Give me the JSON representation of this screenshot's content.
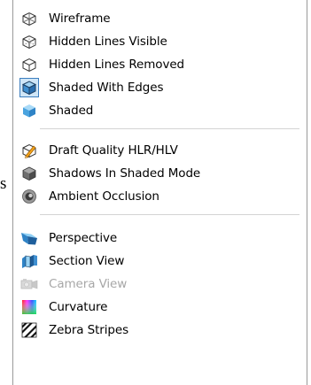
{
  "background_text": "s",
  "menu": {
    "items": [
      {
        "label": "Wireframe",
        "icon": "wireframe-cube-icon"
      },
      {
        "label": "Hidden Lines Visible",
        "icon": "hidden-lines-visible-icon"
      },
      {
        "label": "Hidden Lines Removed",
        "icon": "hidden-lines-removed-icon"
      },
      {
        "label": "Shaded With Edges",
        "icon": "shaded-with-edges-icon",
        "selected": true
      },
      {
        "label": "Shaded",
        "icon": "shaded-cube-icon"
      },
      {
        "label": "Draft Quality HLR/HLV",
        "icon": "draft-quality-icon"
      },
      {
        "label": "Shadows In Shaded Mode",
        "icon": "shadows-icon"
      },
      {
        "label": "Ambient Occlusion",
        "icon": "ambient-occlusion-icon"
      },
      {
        "label": "Perspective",
        "icon": "perspective-icon"
      },
      {
        "label": "Section View",
        "icon": "section-view-icon"
      },
      {
        "label": "Camera View",
        "icon": "camera-view-icon",
        "disabled": true
      },
      {
        "label": "Curvature",
        "icon": "curvature-icon"
      },
      {
        "label": "Zebra Stripes",
        "icon": "zebra-stripes-icon"
      }
    ]
  },
  "colors": {
    "selected_fill": "#cfe6f7",
    "selected_border": "#3d7fbf",
    "shaded_blue": "#4aa3df",
    "disabled_text": "#a7a7a7"
  }
}
